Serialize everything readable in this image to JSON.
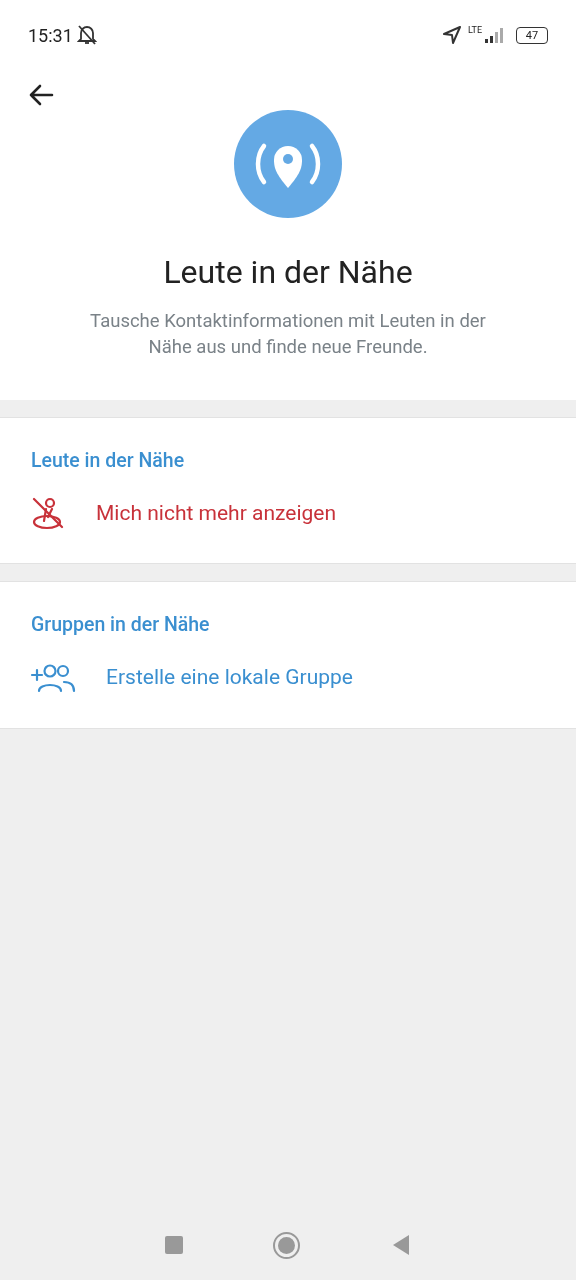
{
  "status_bar": {
    "time": "15:31",
    "network": "LTE",
    "battery": "47"
  },
  "header": {
    "title": "Leute in der Nähe",
    "subtitle": "Tausche Kontaktinformationen mit Leuten in der Nähe aus und finde neue Freunde."
  },
  "sections": [
    {
      "title": "Leute in der Nähe",
      "items": [
        {
          "label": "Mich nicht mehr anzeigen",
          "kind": "hide"
        }
      ]
    },
    {
      "title": "Gruppen in der Nähe",
      "items": [
        {
          "label": "Erstelle eine lokale Gruppe",
          "kind": "create-group"
        }
      ]
    }
  ]
}
